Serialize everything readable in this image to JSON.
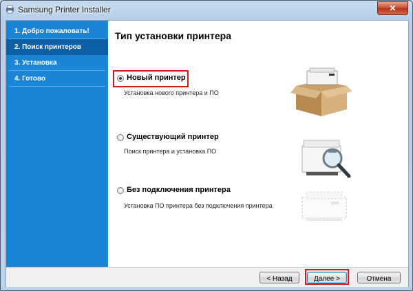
{
  "window": {
    "title": "Samsung Printer Installer",
    "close_label": "✕"
  },
  "sidebar": {
    "steps": [
      {
        "label": "1. Добро пожаловать!"
      },
      {
        "label": "2. Поиск принтеров"
      },
      {
        "label": "3. Установка"
      },
      {
        "label": "4. Готово"
      }
    ],
    "active_index": 1
  },
  "main": {
    "heading": "Тип установки принтера",
    "options": [
      {
        "label": "Новый принтер",
        "description": "Установка нового принтера и ПО",
        "checked": true,
        "icon": "printer-in-box-icon"
      },
      {
        "label": "Существующий принтер",
        "description": "Поиск принтера и установка ПО",
        "checked": false,
        "icon": "printer-magnifier-icon"
      },
      {
        "label": "Без подключения принтера",
        "description": "Установка ПО принтера без подключения принтера",
        "checked": false,
        "icon": "printer-outline-icon"
      }
    ]
  },
  "footer": {
    "back_label": "< Назад",
    "next_label": "Далее >",
    "cancel_label": "Отмена"
  },
  "colors": {
    "sidebar": "#1b84d4",
    "sidebar_active": "#0d5fa6",
    "highlight": "#d2191f"
  }
}
